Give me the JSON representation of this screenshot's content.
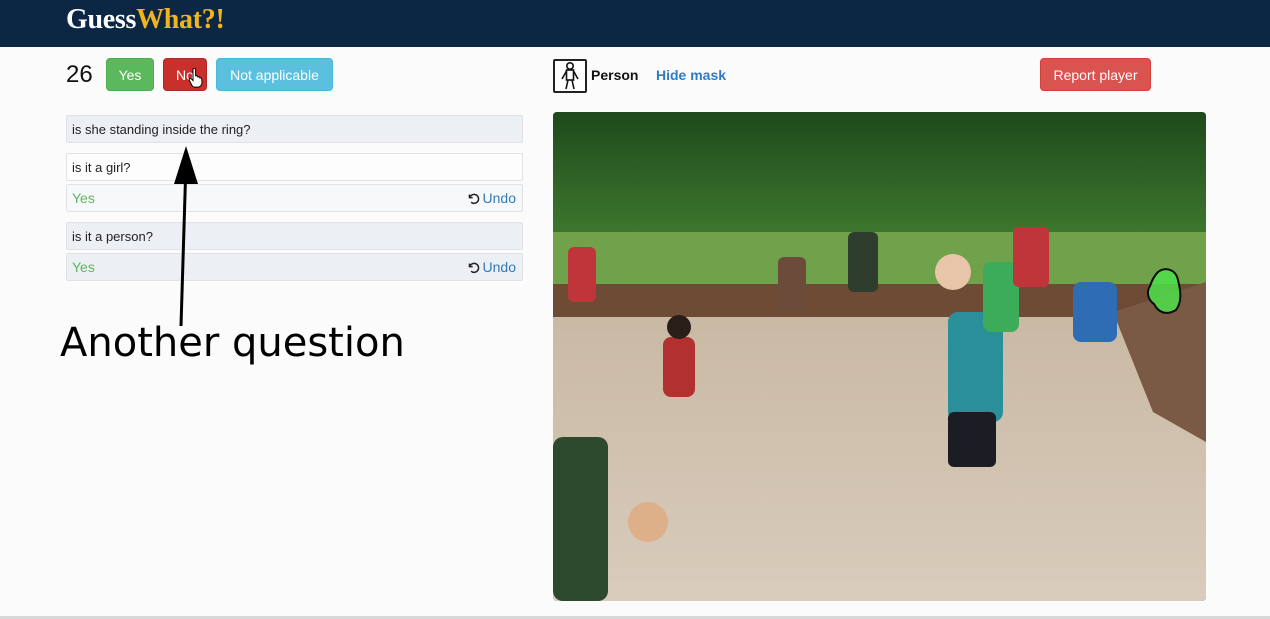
{
  "header": {
    "brand_part1": "Guess",
    "brand_part2": "What?!"
  },
  "game": {
    "counter": "26",
    "yes_label": "Yes",
    "no_label": "No",
    "na_label": "Not applicable"
  },
  "questions": [
    {
      "text": "is she standing inside the ring?"
    },
    {
      "text": "is it a girl?",
      "answer": "Yes",
      "undo": "Undo"
    },
    {
      "text": "is it a person?",
      "answer": "Yes",
      "undo": "Undo"
    }
  ],
  "annotation": {
    "text": "Another question"
  },
  "object": {
    "category": "Person",
    "hide_mask_label": "Hide mask"
  },
  "report_label": "Report player",
  "colors": {
    "navbar": "#0b2744",
    "brand_accent": "#f0b41c",
    "yes": "#5cb85c",
    "no": "#c9302c",
    "na": "#5bc0de",
    "report": "#d9534f",
    "link": "#337ab7",
    "mask": "#4ee04a"
  },
  "icons": {
    "person": "person-icon",
    "undo": "undo-icon",
    "cursor": "hand-cursor-icon"
  }
}
